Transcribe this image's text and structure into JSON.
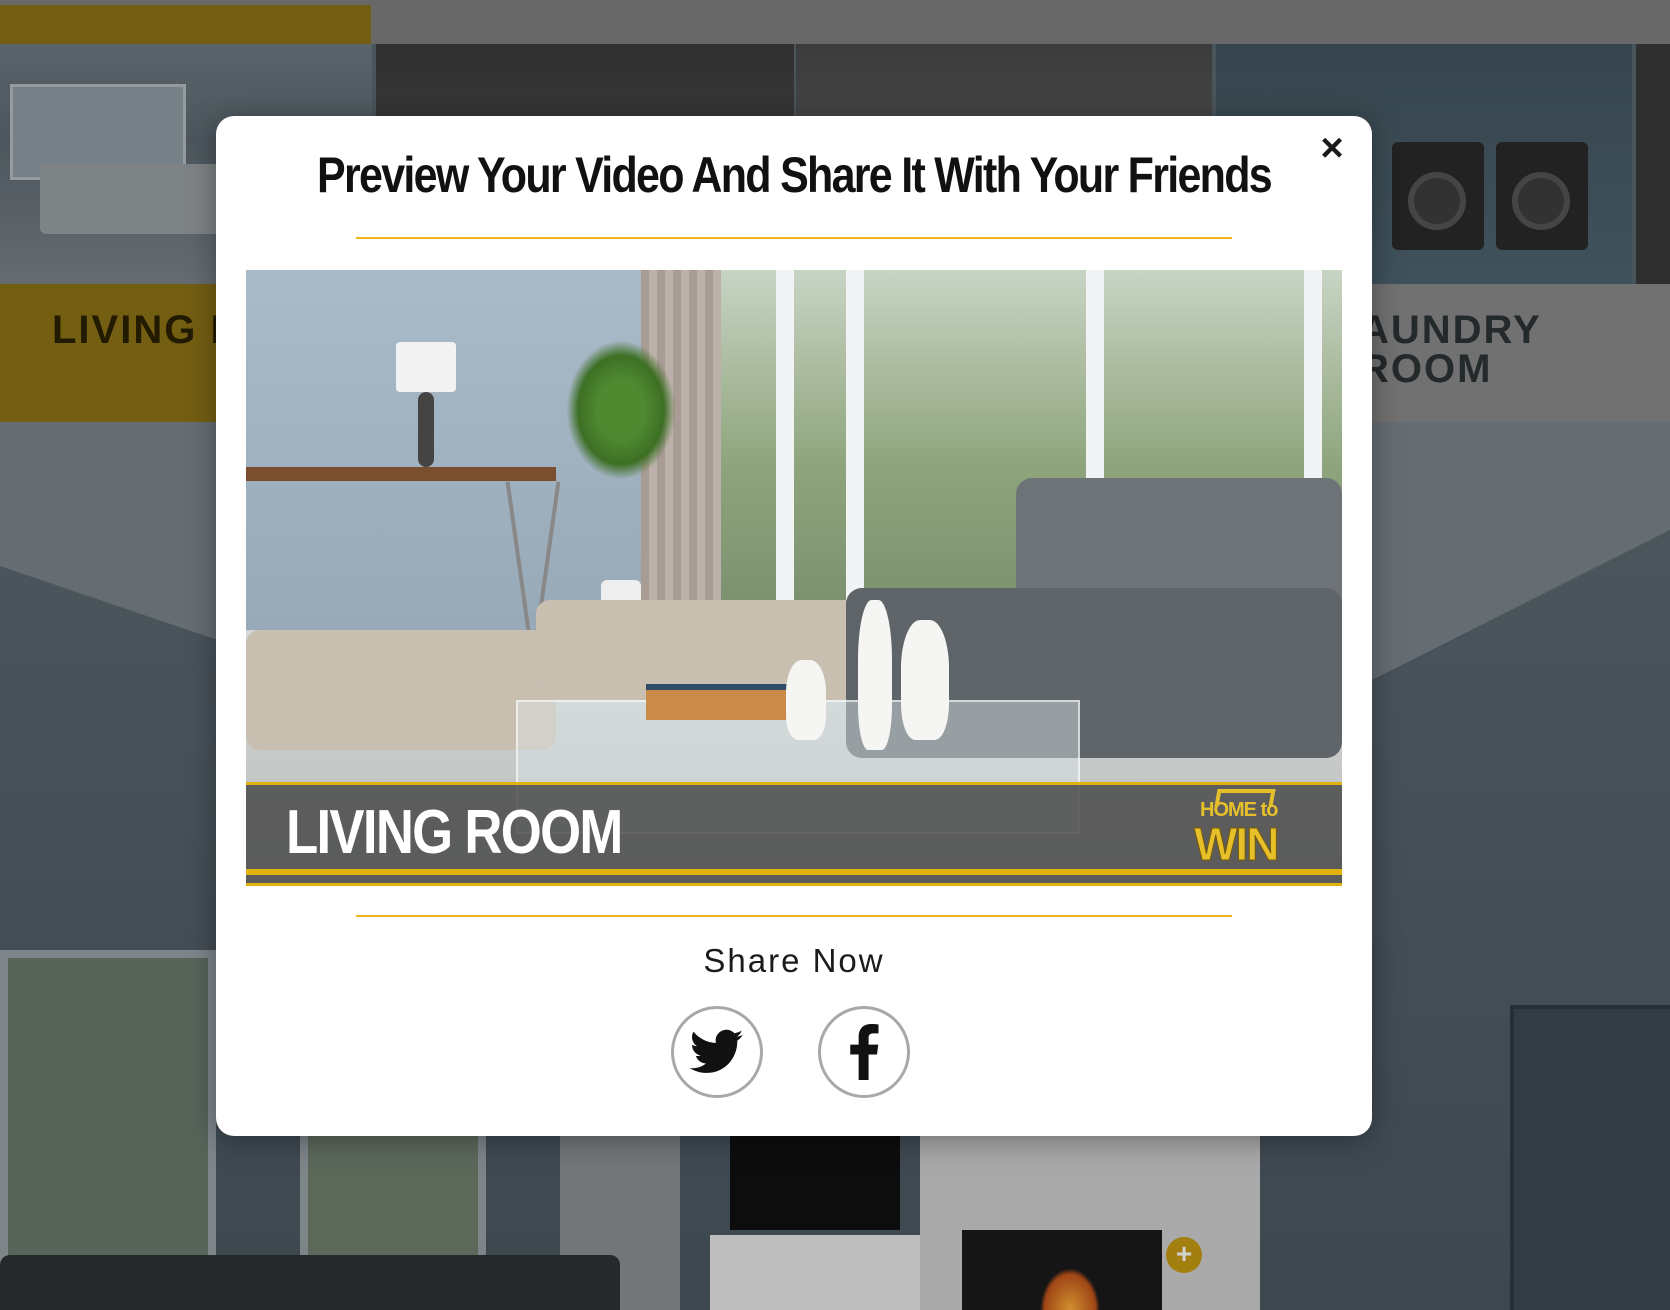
{
  "background": {
    "room_tabs": [
      {
        "label": "LIVING RO",
        "active": true
      },
      {
        "label": "AUNDRY ROOM",
        "line1": "AUNDRY",
        "line2": "ROOM",
        "active": false
      }
    ],
    "hotspot_symbol": "+",
    "accent_color": "#8d7317"
  },
  "modal": {
    "title": "Preview Your Video And Share It With Your Friends",
    "close_symbol": "×",
    "close_icon": "close-icon",
    "rule_color": "#f2b51a",
    "video": {
      "room_label": "LIVING ROOM",
      "logo_top": "HOME to",
      "logo_bottom": "WIN",
      "logo_color": "#e6c02a"
    },
    "share": {
      "title": "Share Now",
      "buttons": [
        {
          "network": "Twitter",
          "icon": "twitter-icon"
        },
        {
          "network": "Facebook",
          "icon": "facebook-icon"
        }
      ]
    }
  }
}
